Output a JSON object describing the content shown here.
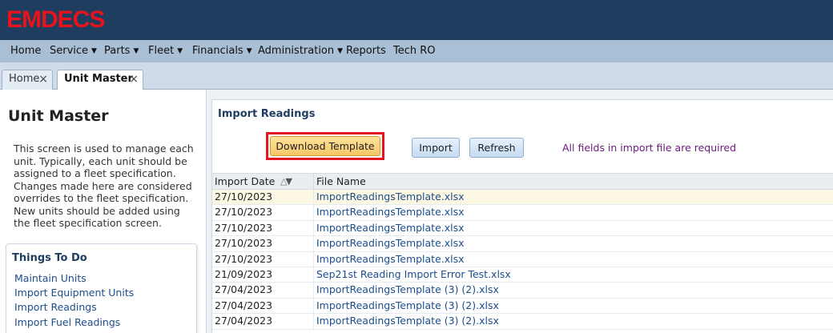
{
  "app": {
    "logo": "EMDECS"
  },
  "menu": [
    {
      "label": "Home",
      "caret": false
    },
    {
      "label": "Service",
      "caret": true
    },
    {
      "label": "Parts",
      "caret": true
    },
    {
      "label": "Fleet",
      "caret": true
    },
    {
      "label": "Financials",
      "caret": true
    },
    {
      "label": "Administration",
      "caret": true
    },
    {
      "label": "Reports",
      "caret": false
    },
    {
      "label": "Tech RO",
      "caret": false
    }
  ],
  "tabs": [
    {
      "label": "Home",
      "close": "×"
    },
    {
      "label": "Unit Master",
      "close": "×"
    }
  ],
  "left": {
    "title": "Unit Master",
    "description": "This screen is used to manage each unit. Typically, each unit should be assigned to a fleet specification. Changes made here are considered overrides to the fleet specification. New units should be added using the fleet specification screen.",
    "todo_title": "Things To Do",
    "todo_links": [
      "Maintain Units",
      "Import Equipment Units",
      "Import Readings",
      "Import Fuel Readings"
    ]
  },
  "main": {
    "section_title": "Import Readings",
    "buttons": {
      "download": "Download Template",
      "import": "Import",
      "refresh": "Refresh"
    },
    "note": "All fields in import file are required",
    "grid": {
      "headers": [
        "Import Date",
        "File Name"
      ],
      "rows": [
        {
          "date": "27/10/2023",
          "file": "ImportReadingsTemplate.xlsx"
        },
        {
          "date": "27/10/2023",
          "file": "ImportReadingsTemplate.xlsx"
        },
        {
          "date": "27/10/2023",
          "file": "ImportReadingsTemplate.xlsx"
        },
        {
          "date": "27/10/2023",
          "file": "ImportReadingsTemplate.xlsx"
        },
        {
          "date": "27/10/2023",
          "file": "ImportReadingsTemplate.xlsx"
        },
        {
          "date": "21/09/2023",
          "file": "Sep21st Reading Import Error Test.xlsx"
        },
        {
          "date": "27/04/2023",
          "file": "ImportReadingsTemplate (3) (2).xlsx"
        },
        {
          "date": "27/04/2023",
          "file": "ImportReadingsTemplate (3) (2).xlsx"
        },
        {
          "date": "27/04/2023",
          "file": "ImportReadingsTemplate (3) (2).xlsx"
        }
      ]
    }
  },
  "colors": {
    "topbar": "#1f3d5f",
    "logo": "#e8141c",
    "menubar": "#a9bfd6",
    "highlight": "#e3161f",
    "link": "#1c4e8c",
    "note": "#6a1b7a"
  }
}
